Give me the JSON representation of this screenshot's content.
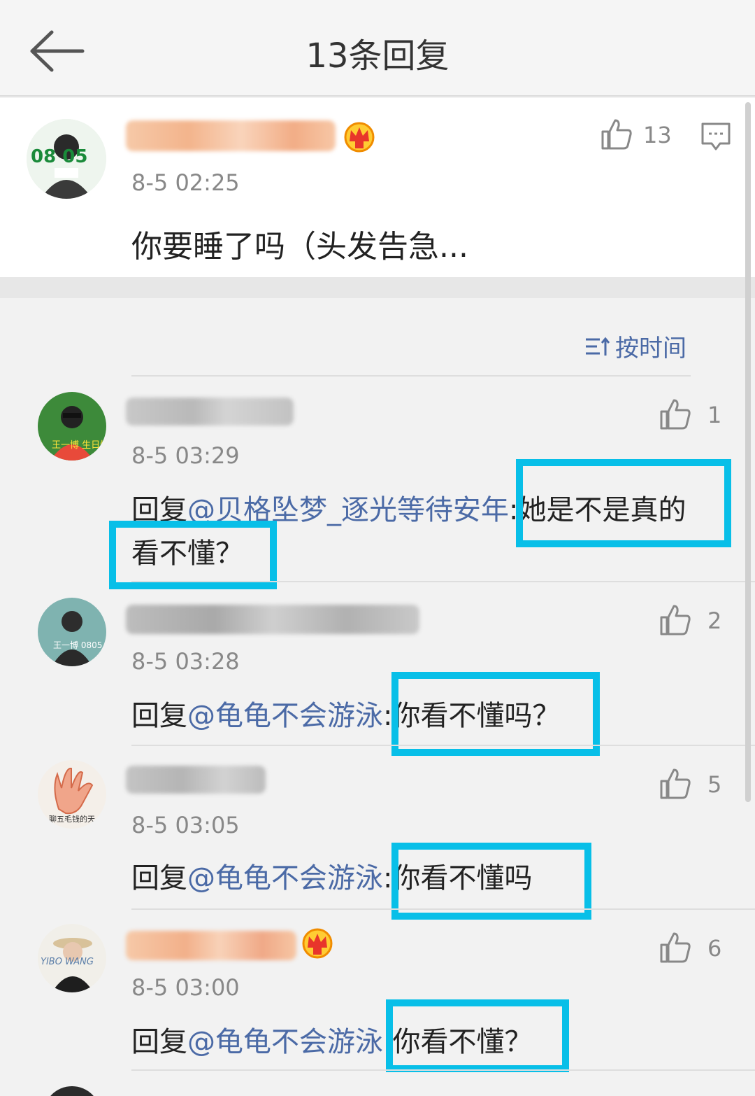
{
  "header": {
    "title": "13条回复"
  },
  "main_comment": {
    "time": "8-5 02:25",
    "likes": "13",
    "text": "你要睡了吗（头发告急..."
  },
  "sort": {
    "label": "按时间"
  },
  "replies": [
    {
      "time": "8-5 03:29",
      "likes": "1",
      "reply_word": "回复",
      "mention": "@贝格坠梦_逐光等待安年",
      "text_line1": ":她是不是真的",
      "text_line2": "看不懂？"
    },
    {
      "time": "8-5 03:28",
      "likes": "2",
      "reply_word": "回复",
      "mention": "@龟龟不会游泳",
      "text": ":你看不懂吗？"
    },
    {
      "time": "8-5 03:05",
      "likes": "5",
      "reply_word": "回复",
      "mention": "@龟龟不会游泳",
      "text": ":你看不懂吗"
    },
    {
      "time": "8-5 03:00",
      "likes": "6",
      "reply_word": "回复",
      "mention": "@龟龟不会游泳",
      "text": ":你看不懂？"
    }
  ],
  "avatar_labels": {
    "main": "08 05",
    "reply1": "王一博 生日快乐",
    "reply2": "王一博 0805",
    "reply3": "聊五毛钱的天",
    "reply4": "YIBO WANG"
  },
  "colors": {
    "highlight_box": "#08bfe8",
    "mention": "#4b6aa6",
    "crown": "#ffb000"
  }
}
